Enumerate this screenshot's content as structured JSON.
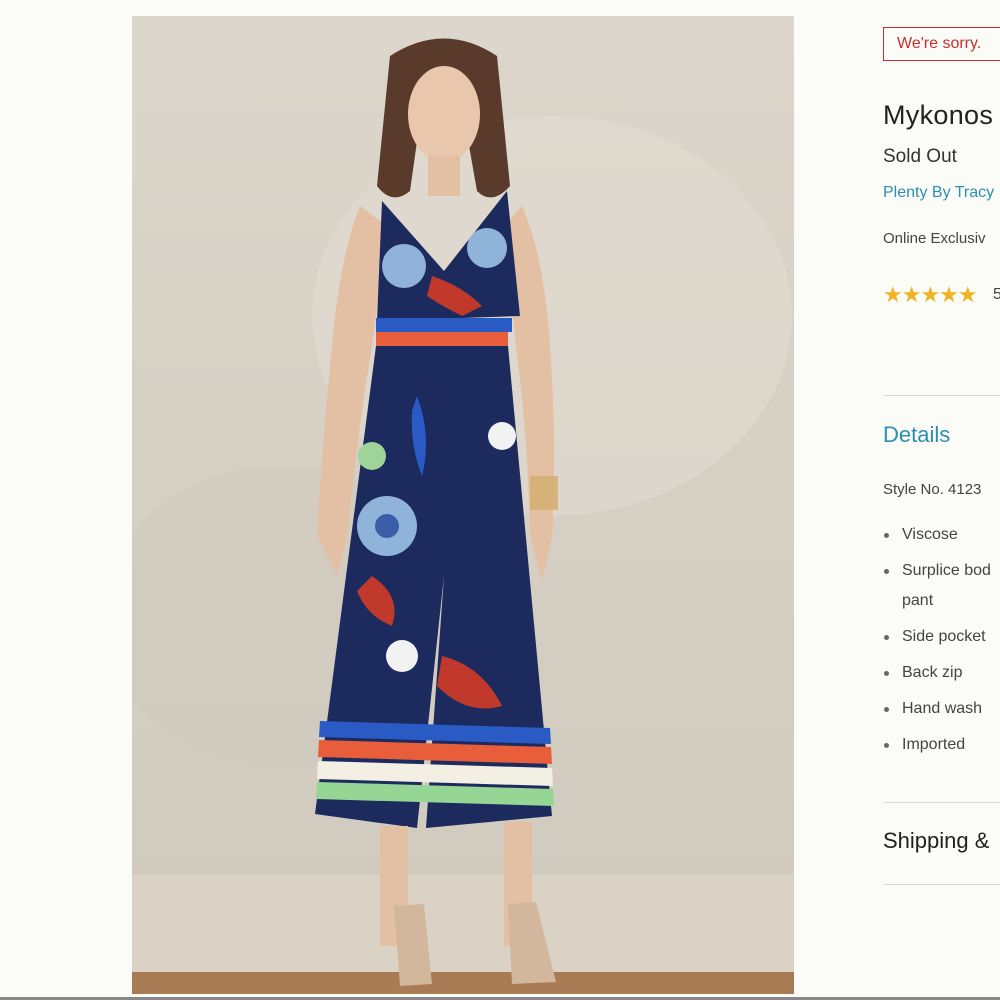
{
  "alert": {
    "text": "We're sorry."
  },
  "product": {
    "title": "Mykonos",
    "status": "Sold Out",
    "brand": "Plenty By Tracy",
    "badge": "Online Exclusiv",
    "rating_stars": "★★★★★",
    "rating_count": "5"
  },
  "details": {
    "heading": "Details",
    "style_no": "Style No. 4123",
    "features": [
      {
        "line1": "Viscose",
        "line2": ""
      },
      {
        "line1": "Surplice bod",
        "line2": "pant"
      },
      {
        "line1": "Side pocket",
        "line2": ""
      },
      {
        "line1": "Back zip",
        "line2": ""
      },
      {
        "line1": "Hand wash",
        "line2": ""
      },
      {
        "line1": "Imported",
        "line2": ""
      }
    ]
  },
  "shipping": {
    "heading": "Shipping &"
  },
  "colors": {
    "accent": "#2b8fb3",
    "alert": "#c9302c",
    "star": "#f0b323",
    "dress_navy": "#1d2a5e"
  },
  "image": {
    "icon": "product-photo"
  }
}
